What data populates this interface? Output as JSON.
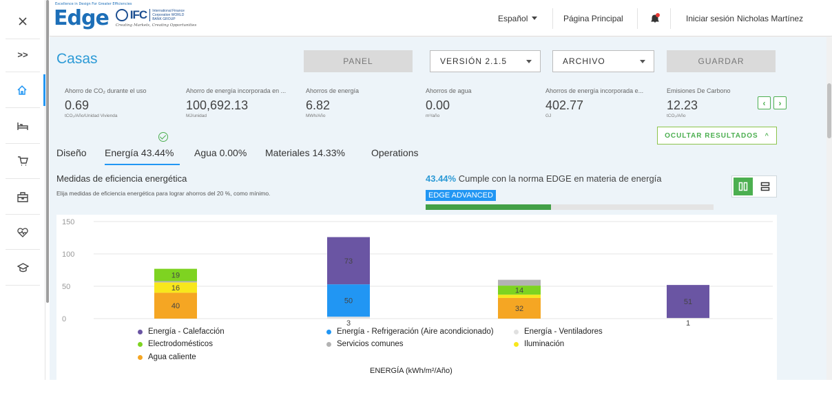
{
  "sidebar": {
    "close_icon": "close-icon",
    "expand_label": ">>",
    "items": [
      {
        "name": "home-icon",
        "active": true
      },
      {
        "name": "bed-icon",
        "active": false
      },
      {
        "name": "cart-icon",
        "active": false
      },
      {
        "name": "briefcase-icon",
        "active": false
      },
      {
        "name": "heart-icon",
        "active": false
      },
      {
        "name": "graduation-cap-icon",
        "active": false
      }
    ]
  },
  "header": {
    "logo": {
      "edge_tagline": "Excellence in Design For Greater Efficiencies",
      "edge_text": "Edge",
      "ifc_text": "IFC",
      "ifc_sub": "International Finance Corporation WORLD BANK GROUP",
      "ifc_tagline": "Creating Markets, Creating Opportunities"
    },
    "language": "Español",
    "home_link": "Página Principal",
    "login_text": "Iniciar sesión",
    "user_name": "Nicholas Martínez",
    "accent_color": "#2c9ad6"
  },
  "main": {
    "title": "Casas",
    "panel_button": "PANEL",
    "version_select": "VERSIÓN 2.1.5",
    "file_select": "ARCHIVO",
    "save_button": "GUARDAR",
    "metrics": [
      {
        "label": "Ahorro de CO₂ durante el uso",
        "value": "0.69",
        "unit": "tCO₂/Año/Unidad Vivienda"
      },
      {
        "label": "Ahorro de energía incorporada en ...",
        "value": "100,692.13",
        "unit": "MJ/unidad"
      },
      {
        "label": "Ahorros de energía",
        "value": "6.82",
        "unit": "MWh/Año"
      },
      {
        "label": "Ahorros de agua",
        "value": "0.00",
        "unit": "m³/año"
      },
      {
        "label": "Ahorros de energía incorporada e...",
        "value": "402.77",
        "unit": "GJ"
      },
      {
        "label": "Emisiones De Carbono",
        "value": "12.23",
        "unit": "tCO₂/Año"
      }
    ],
    "hide_results": "OCULTAR RESULTADOS",
    "tabs": [
      {
        "label": "Diseño"
      },
      {
        "label": "Energía 43.44%"
      },
      {
        "label": "Agua 0.00%"
      },
      {
        "label": "Materiales 14.33%"
      },
      {
        "label": "Operations"
      }
    ],
    "section_title": "Medidas de eficiencia energética",
    "section_subtitle": "Elija medidas de eficiencia energética para lograr ahorros del 20 %, como mínimo.",
    "compliance_pct": "43.44%",
    "compliance_text": " Cumple con la norma EDGE en materia de energía",
    "badge": "EDGE ADVANCED",
    "progress": 0.4344
  },
  "chart_data": {
    "type": "bar",
    "stacked": true,
    "xlabel": "ENERGÍA (kWh/m²/Año)",
    "ylabel": "",
    "ylim": [
      0,
      150
    ],
    "yticks": [
      0,
      50,
      100,
      150
    ],
    "grid": true,
    "legend_position": "bottom",
    "series": [
      {
        "name": "Energía - Calefacción",
        "color": "#6a55a3"
      },
      {
        "name": "Energía - Refrigeración (Aire acondicionado)",
        "color": "#2196f3"
      },
      {
        "name": "Energía - Ventiladores",
        "color": "#e0e0e0"
      },
      {
        "name": "Electrodomésticos",
        "color": "#7ed321"
      },
      {
        "name": "Servicios comunes",
        "color": "#b3b3b3"
      },
      {
        "name": "Iluminación",
        "color": "#f8e71c"
      },
      {
        "name": "Agua caliente",
        "color": "#f5a623"
      }
    ],
    "bars": [
      {
        "segments": [
          {
            "series": "Agua caliente",
            "value": 40,
            "label": "40"
          },
          {
            "series": "Iluminación",
            "value": 16,
            "label": "16"
          },
          {
            "series": "Servicios comunes",
            "value": 2,
            "label": ""
          },
          {
            "series": "Electrodomésticos",
            "value": 19,
            "label": "19"
          }
        ]
      },
      {
        "floating": true,
        "segments": [
          {
            "series": "Energía - Ventiladores",
            "value": 3,
            "label": "3"
          },
          {
            "series": "Energía - Refrigeración (Aire acondicionado)",
            "value": 50,
            "label": "50"
          },
          {
            "series": "Energía - Calefacción",
            "value": 73,
            "label": "73"
          }
        ]
      },
      {
        "segments": [
          {
            "series": "Agua caliente",
            "value": 32,
            "label": "32"
          },
          {
            "series": "Iluminación",
            "value": 5,
            "label": ""
          },
          {
            "series": "Electrodomésticos",
            "value": 14,
            "label": "14"
          },
          {
            "series": "Servicios comunes",
            "value": 9,
            "label": ""
          }
        ]
      },
      {
        "floating": true,
        "segments": [
          {
            "series": "Energía - Ventiladores",
            "value": 1,
            "label": "1"
          },
          {
            "series": "Energía - Calefacción",
            "value": 51,
            "label": "51"
          }
        ]
      }
    ]
  }
}
